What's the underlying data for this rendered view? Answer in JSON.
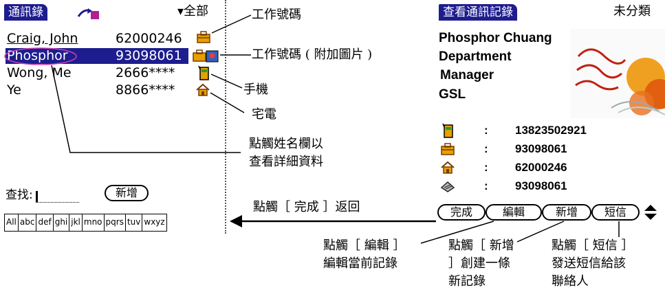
{
  "left": {
    "title": "通訊錄",
    "category": "▾全部",
    "contacts": [
      {
        "name": "Craig, John",
        "number": "62000246"
      },
      {
        "name": "Phosphor",
        "number": "93098061"
      },
      {
        "name": "Wong, Me",
        "number": "2666****"
      },
      {
        "name": "Ye",
        "number": "8866****"
      }
    ],
    "find_label": "查找:",
    "new_button": "新增",
    "alpha_tabs": [
      "All",
      "abc",
      "def",
      "ghi",
      "jkl",
      "mno",
      "pqrs",
      "tuv",
      "wxyz"
    ]
  },
  "right": {
    "title": "查看通訊記錄",
    "category": "未分類",
    "lines": [
      "Phosphor Chuang",
      "Department",
      "Manager",
      "GSL"
    ],
    "phones": [
      {
        "icon": "mobile-icon",
        "sep": ":",
        "value": "13823502921"
      },
      {
        "icon": "work-icon",
        "sep": ":",
        "value": "93098061"
      },
      {
        "icon": "home-icon",
        "sep": ":",
        "value": "62000246"
      },
      {
        "icon": "fax-icon",
        "sep": ":",
        "value": "93098061"
      }
    ],
    "buttons": {
      "done": "完成",
      "edit": "編輯",
      "new": "新增",
      "sms": "短信"
    }
  },
  "annotations": {
    "work_number": "工作號碼",
    "work_number_photo": "工作號碼 ( 附加圖片 )",
    "mobile": "手機",
    "home": "宅電",
    "tap_name_1": "點觸姓名欄以",
    "tap_name_2": "查看詳細資料",
    "tap_done": "點觸［ 完成 ］返回",
    "tap_edit_1": "點觸［ 編輯 ］",
    "tap_edit_2": "編輯當前記錄",
    "tap_new_1": "點觸［ 新增",
    "tap_new_2": "］創建一條",
    "tap_new_3": "新記錄",
    "tap_sms_1": "點觸［ 短信 ］",
    "tap_sms_2": "發送短信給該",
    "tap_sms_3": "聯絡人"
  },
  "colors": {
    "title_bg": "#1d1d8f",
    "circle": "#d040b0"
  }
}
